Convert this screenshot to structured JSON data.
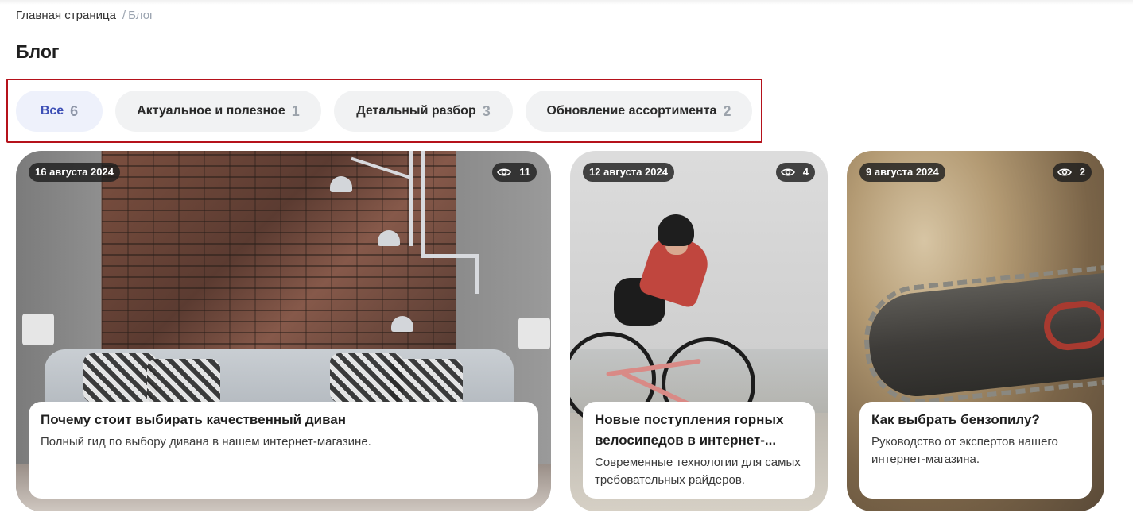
{
  "breadcrumb": {
    "home": "Главная страница",
    "separator": "/",
    "current": "Блог"
  },
  "page": {
    "title": "Блог"
  },
  "tabs": [
    {
      "label": "Все",
      "count": "6",
      "active": true
    },
    {
      "label": "Актуальное и полезное",
      "count": "1"
    },
    {
      "label": "Детальный разбор",
      "count": "3"
    },
    {
      "label": "Обновление ассортимента",
      "count": "2"
    }
  ],
  "cards": [
    {
      "date": "16 августа 2024",
      "views": "11",
      "title": "Почему стоит выбирать качественный диван",
      "description": "Полный гид по выбору дивана в нашем интернет-магазине.",
      "image": "living-room-sofa"
    },
    {
      "date": "12 августа 2024",
      "views": "4",
      "title": "Новые поступления горных велосипедов в интернет-...",
      "description": "Современные технологии для самых требовательных райдеров.",
      "image": "cyclist-road-bike"
    },
    {
      "date": "9 августа 2024",
      "views": "2",
      "title": "Как выбрать бензопилу?",
      "description": "Руководство от экспертов нашего интернет-магазина.",
      "image": "chainsaw-bar"
    }
  ],
  "colors": {
    "active_tab_bg": "#eef1fb",
    "active_tab_text": "#3d4fb6",
    "tab_bg": "#f1f2f3",
    "highlight_border": "#b5121b"
  },
  "icons": {
    "views": "eye-icon"
  }
}
